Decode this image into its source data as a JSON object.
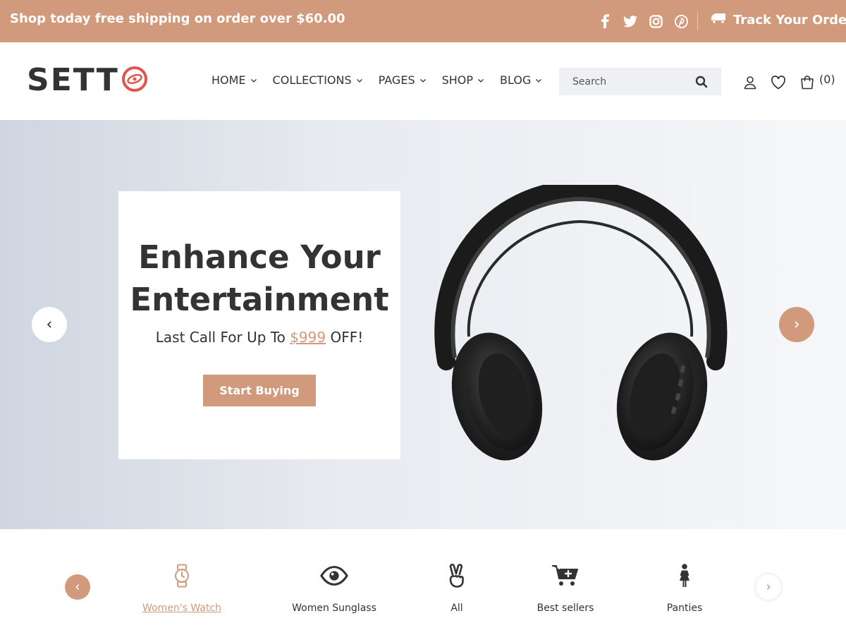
{
  "topbar": {
    "promo": "Shop today free shipping on order over $60.00",
    "social_icons": [
      "facebook-icon",
      "twitter-icon",
      "instagram-icon",
      "pinterest-icon"
    ],
    "track_label": "Track Your Order"
  },
  "header": {
    "logo_text": "SETT",
    "nav": [
      "HOME",
      "COLLECTIONS",
      "PAGES",
      "SHOP",
      "BLOG"
    ],
    "search_placeholder": "Search",
    "cart_count": "(0)"
  },
  "hero": {
    "title": "Enhance Your Entertainment",
    "subtitle_prefix": "Last Call For Up To ",
    "subtitle_price": "$999",
    "subtitle_suffix": " OFF!",
    "button_label": "Start Buying"
  },
  "categories": {
    "items": [
      {
        "label": "Women's Watch",
        "icon": "watch-icon",
        "active": true
      },
      {
        "label": "Women Sunglass",
        "icon": "eye-icon",
        "active": false
      },
      {
        "label": "All",
        "icon": "peace-hand-icon",
        "active": false
      },
      {
        "label": "Best sellers",
        "icon": "cart-plus-icon",
        "active": false
      },
      {
        "label": "Panties",
        "icon": "female-icon",
        "active": false
      }
    ]
  },
  "colors": {
    "accent": "#d19a7c",
    "text": "#333333",
    "search_bg": "#eef0f3"
  }
}
